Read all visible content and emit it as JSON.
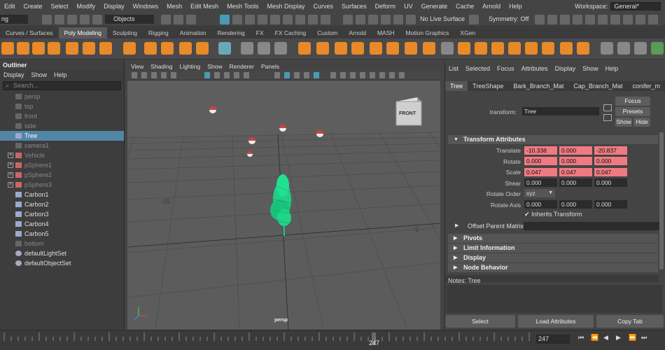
{
  "menubar": [
    "Edit",
    "Create",
    "Select",
    "Modify",
    "Display",
    "Windows",
    "Mesh",
    "Edit Mesh",
    "Mesh Tools",
    "Mesh Display",
    "Curves",
    "Surfaces",
    "Deform",
    "UV",
    "Generate",
    "Cache",
    "Arnold",
    "Help"
  ],
  "workspace": {
    "label": "Workspace:",
    "value": "General*"
  },
  "status": {
    "mode": "ng",
    "select_mask": "Objects",
    "live": "No Live Surface",
    "symmetry": "Symmetry: Off"
  },
  "shelf_tabs": [
    "Curves / Surfaces",
    "Poly Modeling",
    "Sculpting",
    "Rigging",
    "Animation",
    "Rendering",
    "FX",
    "FX Caching",
    "Custom",
    "Arnold",
    "MASH",
    "Motion Graphics",
    "XGen"
  ],
  "shelf_active": "Poly Modeling",
  "outliner": {
    "title": "Outliner",
    "menu": [
      "Display",
      "Show",
      "Help"
    ],
    "search_placeholder": "Search...",
    "items": [
      {
        "label": "persp",
        "dim": true,
        "icon": "camera-icon"
      },
      {
        "label": "top",
        "dim": true,
        "icon": "camera-icon"
      },
      {
        "label": "front",
        "dim": true,
        "icon": "camera-icon"
      },
      {
        "label": "side",
        "dim": true,
        "icon": "camera-icon"
      },
      {
        "label": "Tree",
        "dim": false,
        "icon": "transform-icon",
        "selected": true
      },
      {
        "label": "camera1",
        "dim": true,
        "icon": "camera-icon"
      },
      {
        "label": "Vehicle",
        "dim": true,
        "icon": "mesh-icon",
        "expand": true
      },
      {
        "label": "pSphere1",
        "dim": true,
        "icon": "mesh-icon",
        "expand": true
      },
      {
        "label": "pSphere2",
        "dim": true,
        "icon": "mesh-icon",
        "expand": true
      },
      {
        "label": "pSphere3",
        "dim": true,
        "icon": "mesh-icon",
        "expand": true
      },
      {
        "label": "Carbon1",
        "dim": false,
        "icon": "transform-icon"
      },
      {
        "label": "Carbon2",
        "dim": false,
        "icon": "transform-icon"
      },
      {
        "label": "Carbon3",
        "dim": false,
        "icon": "transform-icon"
      },
      {
        "label": "Carbon4",
        "dim": false,
        "icon": "transform-icon"
      },
      {
        "label": "Carbon5",
        "dim": false,
        "icon": "transform-icon"
      },
      {
        "label": "bottom",
        "dim": true,
        "icon": "camera-icon"
      },
      {
        "label": "defaultLightSet",
        "dim": false,
        "icon": "set-icon"
      },
      {
        "label": "defaultObjectSet",
        "dim": false,
        "icon": "set-icon"
      }
    ]
  },
  "viewport": {
    "menu": [
      "View",
      "Shading",
      "Lighting",
      "Show",
      "Renderer",
      "Panels"
    ],
    "camera_label": "persp",
    "cube_label": "FRONT",
    "grid_labels": [
      "-15",
      "-5"
    ]
  },
  "attr_editor": {
    "menu": [
      "List",
      "Selected",
      "Focus",
      "Attributes",
      "Display",
      "Show",
      "Help"
    ],
    "tabs": [
      "Tree",
      "TreeShape",
      "Bark_Branch_Mat",
      "Cap_Branch_Mat",
      "conifer_m"
    ],
    "transform_label": "transform:",
    "transform_value": "Tree",
    "buttons": {
      "focus": "Focus",
      "presets": "Presets",
      "show": "Show",
      "hide": "Hide"
    },
    "section_transform": "Transform Attributes",
    "translate": {
      "label": "Translate",
      "values": [
        "-10.338",
        "0.000",
        "-20.837"
      ]
    },
    "rotate": {
      "label": "Rotate",
      "values": [
        "0.000",
        "0.000",
        "0.000"
      ]
    },
    "scale": {
      "label": "Scale",
      "values": [
        "0.047",
        "0.047",
        "0.047"
      ]
    },
    "shear": {
      "label": "Shear",
      "values": [
        "0.000",
        "0.000",
        "0.000"
      ]
    },
    "rotate_order": {
      "label": "Rotate Order",
      "value": "xyz"
    },
    "rotate_axis": {
      "label": "Rotate Axis",
      "values": [
        "0.000",
        "0.000",
        "0.000"
      ]
    },
    "inherits": "Inherits Transform",
    "offset_parent": "Offset Parent Matrix",
    "sections": [
      "Pivots",
      "Limit Information",
      "Display",
      "Node Behavior"
    ],
    "notes": "Notes:  Tree",
    "bottom_buttons": [
      "Select",
      "Load Attributes",
      "Copy Tab"
    ]
  },
  "timeline": {
    "current_frame": "247",
    "frame_field": "247"
  }
}
